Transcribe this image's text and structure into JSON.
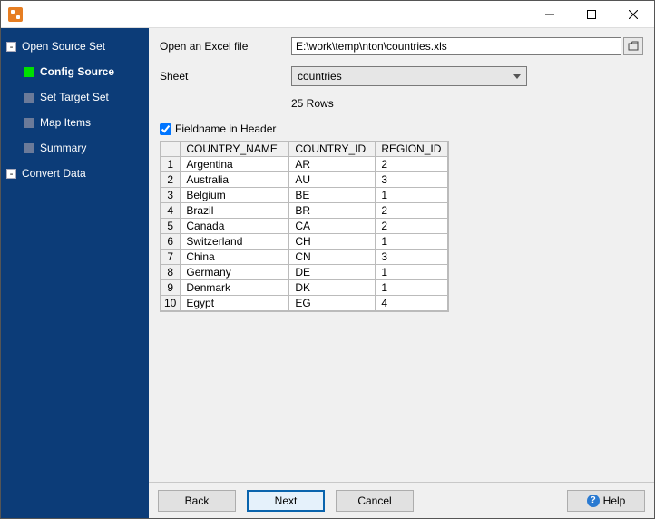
{
  "sidebar": {
    "items": [
      {
        "label": "Open Source Set",
        "expandable": true,
        "child": false,
        "active": false
      },
      {
        "label": "Config Source",
        "expandable": false,
        "child": true,
        "active": true
      },
      {
        "label": "Set Target Set",
        "expandable": false,
        "child": true,
        "active": false
      },
      {
        "label": "Map Items",
        "expandable": false,
        "child": true,
        "active": false
      },
      {
        "label": "Summary",
        "expandable": false,
        "child": true,
        "active": false
      },
      {
        "label": "Convert Data",
        "expandable": true,
        "child": false,
        "active": false
      }
    ]
  },
  "form": {
    "file_label": "Open an Excel file",
    "file_value": "E:\\work\\temp\\nton\\countries.xls",
    "sheet_label": "Sheet",
    "sheet_value": "countries",
    "rowcount": "25 Rows",
    "fieldname_checkbox_label": "Fieldname in Header",
    "fieldname_checked": true
  },
  "grid": {
    "columns": [
      "COUNTRY_NAME",
      "COUNTRY_ID",
      "REGION_ID"
    ],
    "rows": [
      {
        "n": "1",
        "c": [
          "Argentina",
          "AR",
          "2"
        ]
      },
      {
        "n": "2",
        "c": [
          "Australia",
          "AU",
          "3"
        ]
      },
      {
        "n": "3",
        "c": [
          "Belgium",
          "BE",
          "1"
        ]
      },
      {
        "n": "4",
        "c": [
          "Brazil",
          "BR",
          "2"
        ]
      },
      {
        "n": "5",
        "c": [
          "Canada",
          "CA",
          "2"
        ]
      },
      {
        "n": "6",
        "c": [
          "Switzerland",
          "CH",
          "1"
        ]
      },
      {
        "n": "7",
        "c": [
          "China",
          "CN",
          "3"
        ]
      },
      {
        "n": "8",
        "c": [
          "Germany",
          "DE",
          "1"
        ]
      },
      {
        "n": "9",
        "c": [
          "Denmark",
          "DK",
          "1"
        ]
      },
      {
        "n": "10",
        "c": [
          "Egypt",
          "EG",
          "4"
        ]
      }
    ]
  },
  "buttons": {
    "back": "Back",
    "next": "Next",
    "cancel": "Cancel",
    "help": "Help"
  }
}
